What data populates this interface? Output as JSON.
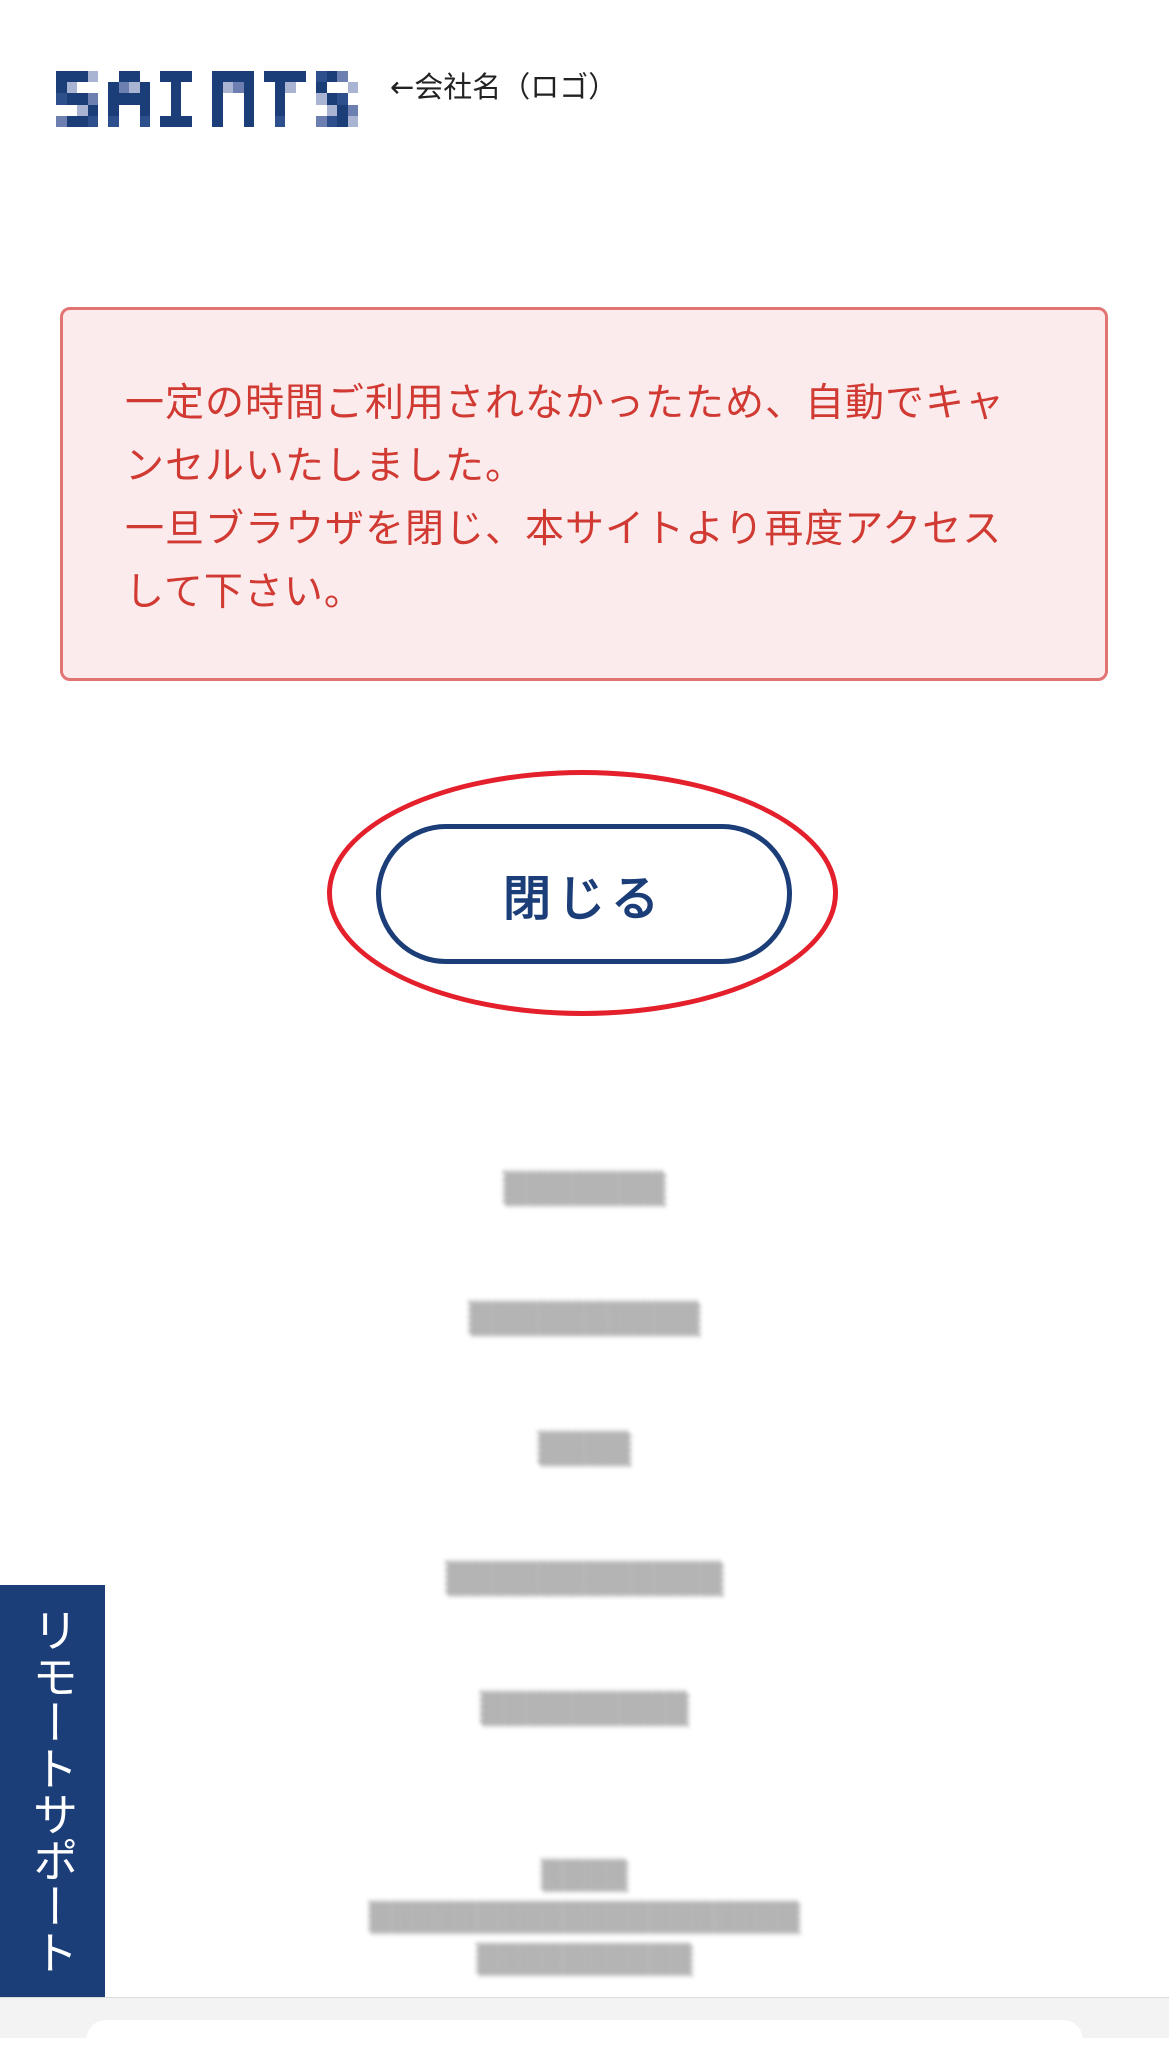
{
  "header": {
    "logo_text": "SAINTS",
    "logo_note": "←会社名（ロゴ）"
  },
  "alert": {
    "lines": [
      "一定の時間ご利用されなかったため、自動でキャ",
      "ンセルいたしました。",
      "一旦ブラウザを閉じ、本サイトより再度アクセス",
      "して下さい。"
    ]
  },
  "close_button": {
    "label": "閉じる"
  },
  "remote_support": {
    "label": "リモートサポート"
  },
  "colors": {
    "brand": "#1b3d78",
    "alert_text": "#d13a33",
    "alert_bg": "#fcebec",
    "alert_border": "#e37474",
    "highlight": "#e3202b"
  }
}
